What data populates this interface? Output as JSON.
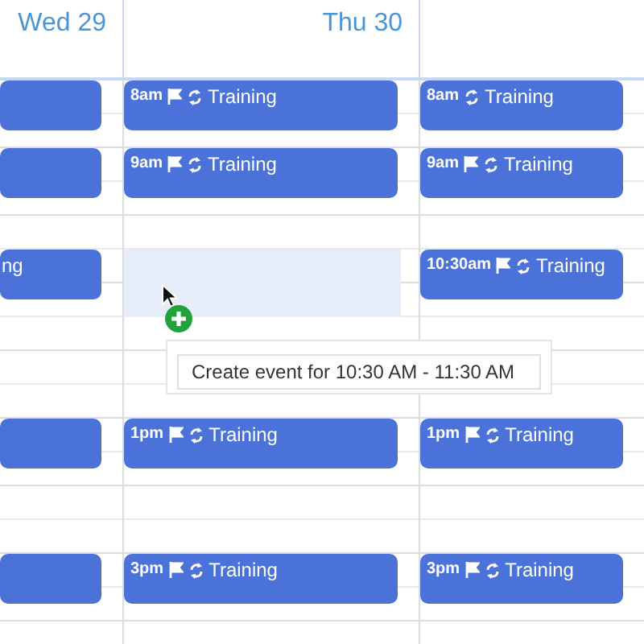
{
  "days": [
    {
      "label": "Wed 29"
    },
    {
      "label": "Thu 30"
    }
  ],
  "rows": [
    {
      "cells": [
        {
          "kind": "event"
        },
        {
          "kind": "event",
          "time": "8am",
          "flag": true,
          "repeat": true,
          "title": "Training"
        },
        {
          "kind": "event",
          "time": "8am",
          "flag": false,
          "repeat": true,
          "title": "Training"
        }
      ]
    },
    {
      "cells": [
        null,
        null,
        null
      ]
    },
    {
      "cells": [
        {
          "kind": "event"
        },
        {
          "kind": "event",
          "time": "9am",
          "flag": true,
          "repeat": true,
          "title": "Training"
        },
        {
          "kind": "event",
          "time": "9am",
          "flag": true,
          "repeat": true,
          "title": "Training"
        }
      ]
    },
    {
      "cells": [
        null,
        null,
        null
      ]
    },
    {
      "cells": [
        null,
        null,
        null
      ]
    },
    {
      "cells": [
        {
          "kind": "event",
          "title": "ng"
        },
        {
          "kind": "selection",
          "tooltip": "Create event for 10:30 AM - 11:30 AM"
        },
        {
          "kind": "event",
          "time": "10:30am",
          "flag": true,
          "repeat": true,
          "title": "Training"
        }
      ]
    },
    {
      "cells": [
        null,
        null,
        null
      ]
    },
    {
      "cells": [
        null,
        null,
        null
      ]
    },
    {
      "cells": [
        null,
        null,
        null
      ]
    },
    {
      "cells": [
        null,
        null,
        null
      ]
    },
    {
      "cells": [
        {
          "kind": "event"
        },
        {
          "kind": "event",
          "time": "1pm",
          "flag": true,
          "repeat": true,
          "title": "Training"
        },
        {
          "kind": "event",
          "time": "1pm",
          "flag": true,
          "repeat": true,
          "title": "Training"
        }
      ]
    },
    {
      "cells": [
        null,
        null,
        null
      ]
    },
    {
      "cells": [
        null,
        null,
        null
      ]
    },
    {
      "cells": [
        null,
        null,
        null
      ]
    },
    {
      "cells": [
        {
          "kind": "event"
        },
        {
          "kind": "event",
          "time": "3pm",
          "flag": true,
          "repeat": true,
          "title": "Training"
        },
        {
          "kind": "event",
          "time": "3pm",
          "flag": true,
          "repeat": true,
          "title": "Training"
        }
      ]
    }
  ]
}
